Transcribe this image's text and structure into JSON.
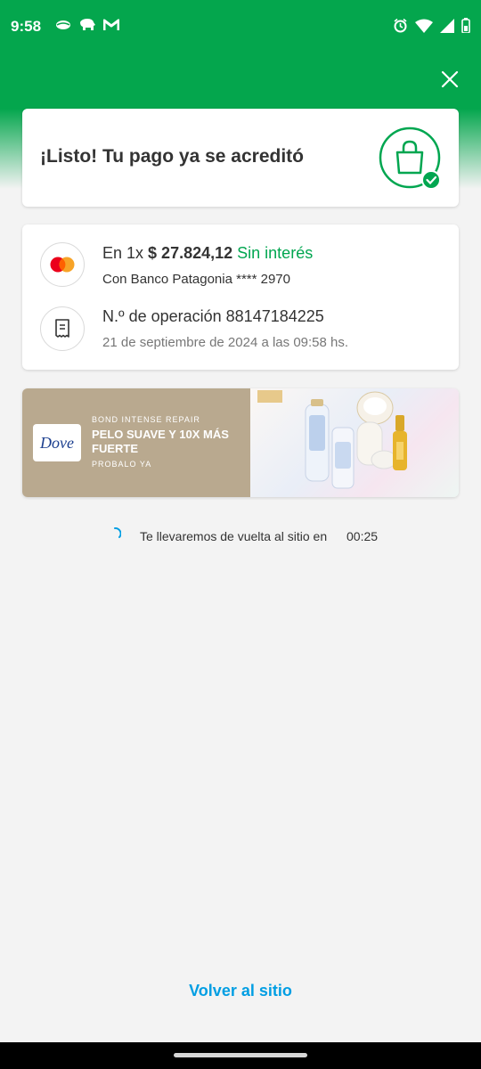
{
  "status_bar": {
    "time": "9:58",
    "left_icons": [
      "leaf-app-icon",
      "elephant-app-icon",
      "gmail-icon"
    ],
    "right_icons": [
      "alarm-icon",
      "wifi-icon",
      "signal-icon",
      "battery-icon"
    ]
  },
  "header": {
    "color": "#04a64d",
    "close_icon": "close-icon"
  },
  "success_card": {
    "title": "¡Listo! Tu pago ya se acreditó",
    "icon": "shopping-bag-check-icon"
  },
  "payment": {
    "installments": "En 1x",
    "amount": "$ 27.824,12",
    "interest": "Sin interés",
    "card_info": "Con Banco Patagonia **** 2970",
    "card_icon": "mastercard-icon",
    "operation_label": "N.º de operación 88147184225",
    "date": "21 de septiembre de 2024 a las 09:58 hs.",
    "receipt_icon": "receipt-icon"
  },
  "banner": {
    "brand": "Dove",
    "tagline": "BOND INTENSE REPAIR",
    "headline": "PELO SUAVE Y 10X MÁS FUERTE",
    "cta": "PROBALO YA"
  },
  "countdown": {
    "text": "Te llevaremos de vuelta al sitio en",
    "time": "00:25"
  },
  "footer": {
    "back_label": "Volver al sitio"
  },
  "colors": {
    "brand_green": "#04a64d",
    "text_green": "#00a650",
    "link_blue": "#009ee3"
  }
}
